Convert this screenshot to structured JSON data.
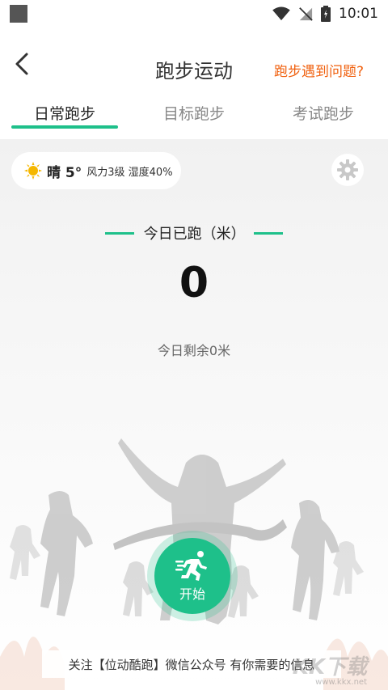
{
  "status_bar": {
    "time": "10:01"
  },
  "header": {
    "title": "跑步运动",
    "help_link": "跑步遇到问题?"
  },
  "tabs": [
    {
      "label": "日常跑步",
      "active": true
    },
    {
      "label": "目标跑步",
      "active": false
    },
    {
      "label": "考试跑步",
      "active": false
    }
  ],
  "weather": {
    "condition": "晴 5°",
    "detail": "风力3级 湿度40%",
    "icon": "sun-icon"
  },
  "today": {
    "label": "今日已跑（米）",
    "distance": "0",
    "remaining": "今日剩余0米"
  },
  "start_button": {
    "label": "开始"
  },
  "footer": {
    "banner": "关注【位动酷跑】微信公众号 有你需要的信息"
  },
  "watermark": {
    "text": "KK下载",
    "url": "www.kkx.net"
  },
  "colors": {
    "accent": "#1ec08a",
    "link": "#f0600e"
  }
}
